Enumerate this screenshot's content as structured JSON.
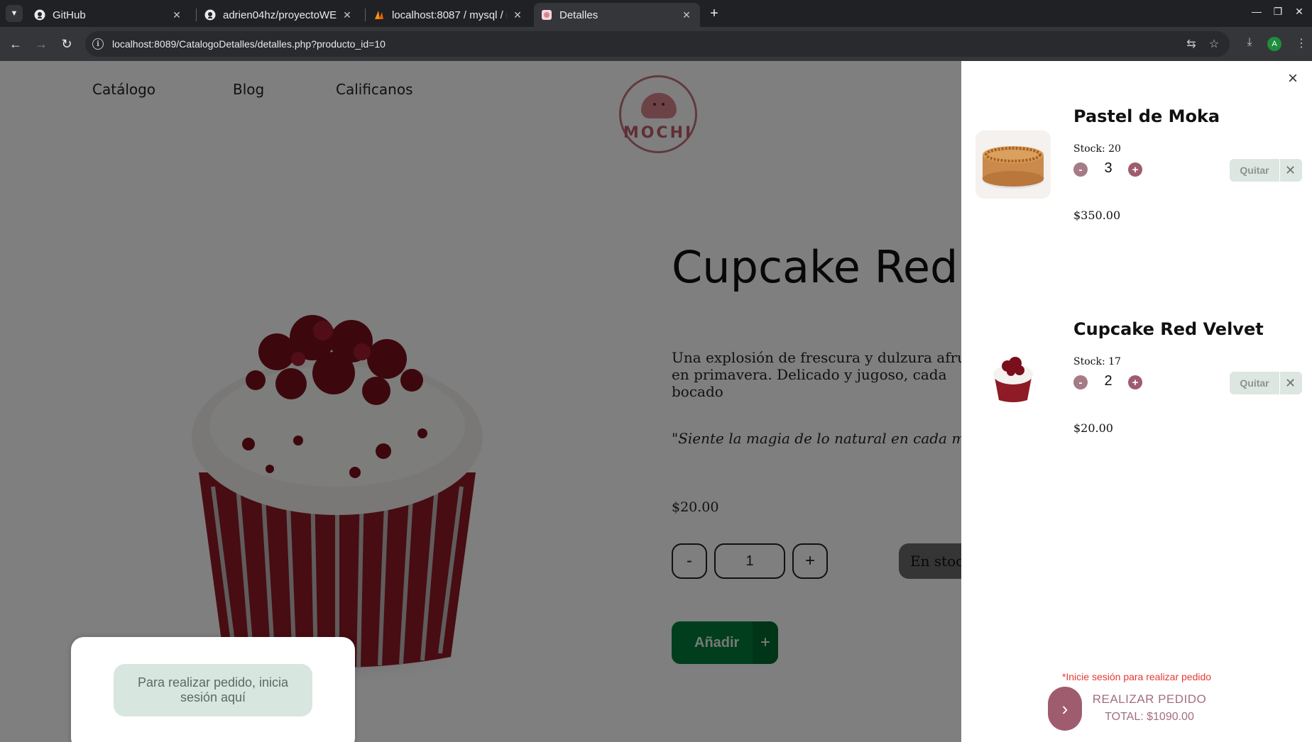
{
  "browser": {
    "tabs": [
      {
        "label": "GitHub",
        "icon": "github-icon"
      },
      {
        "label": "adrien04hz/proyectoWE",
        "icon": "github-icon"
      },
      {
        "label": "localhost:8087 / mysql / r",
        "icon": "phpmyadmin-icon"
      },
      {
        "label": "Detalles",
        "icon": "mochi-favicon-icon"
      }
    ],
    "url": "localhost:8089/CatalogoDetalles/detalles.php?producto_id=10",
    "profile_initial": "A"
  },
  "site": {
    "nav": [
      "Catálogo",
      "Blog",
      "Calificanos"
    ],
    "logo_text": "MOCHI"
  },
  "product": {
    "title": "Cupcake Red Velvet",
    "description": "Una explosión de frescura y dulzura afrutada en primavera. Delicado y jugoso, cada bocado",
    "quote": "\"Siente la magia de lo natural en cada momento\"",
    "price": "$20.00",
    "qty_minus": "-",
    "qty_value": "1",
    "qty_plus": "+",
    "stock_label": "En stock",
    "add_label": "Añadir",
    "add_icon": "+"
  },
  "login_prompt": {
    "button": "Para realizar pedido, inicia sesión aquí"
  },
  "cart": {
    "items": [
      {
        "name": "Pastel de Moka",
        "stock": "Stock: 20",
        "qty": "3",
        "price": "$350.00",
        "remove": "Quitar"
      },
      {
        "name": "Cupcake Red Velvet",
        "stock": "Stock: 17",
        "qty": "2",
        "price": "$20.00",
        "remove": "Quitar"
      }
    ],
    "warning": "*Inicie sesión para realizar pedido",
    "checkout_label": "REALIZAR PEDIDO",
    "total": "TOTAL: $1090.00"
  },
  "colors": {
    "accent": "#a05c6f",
    "add_button": "#017d3a",
    "warning": "#e53935",
    "remove_button": "#dde6e1"
  }
}
